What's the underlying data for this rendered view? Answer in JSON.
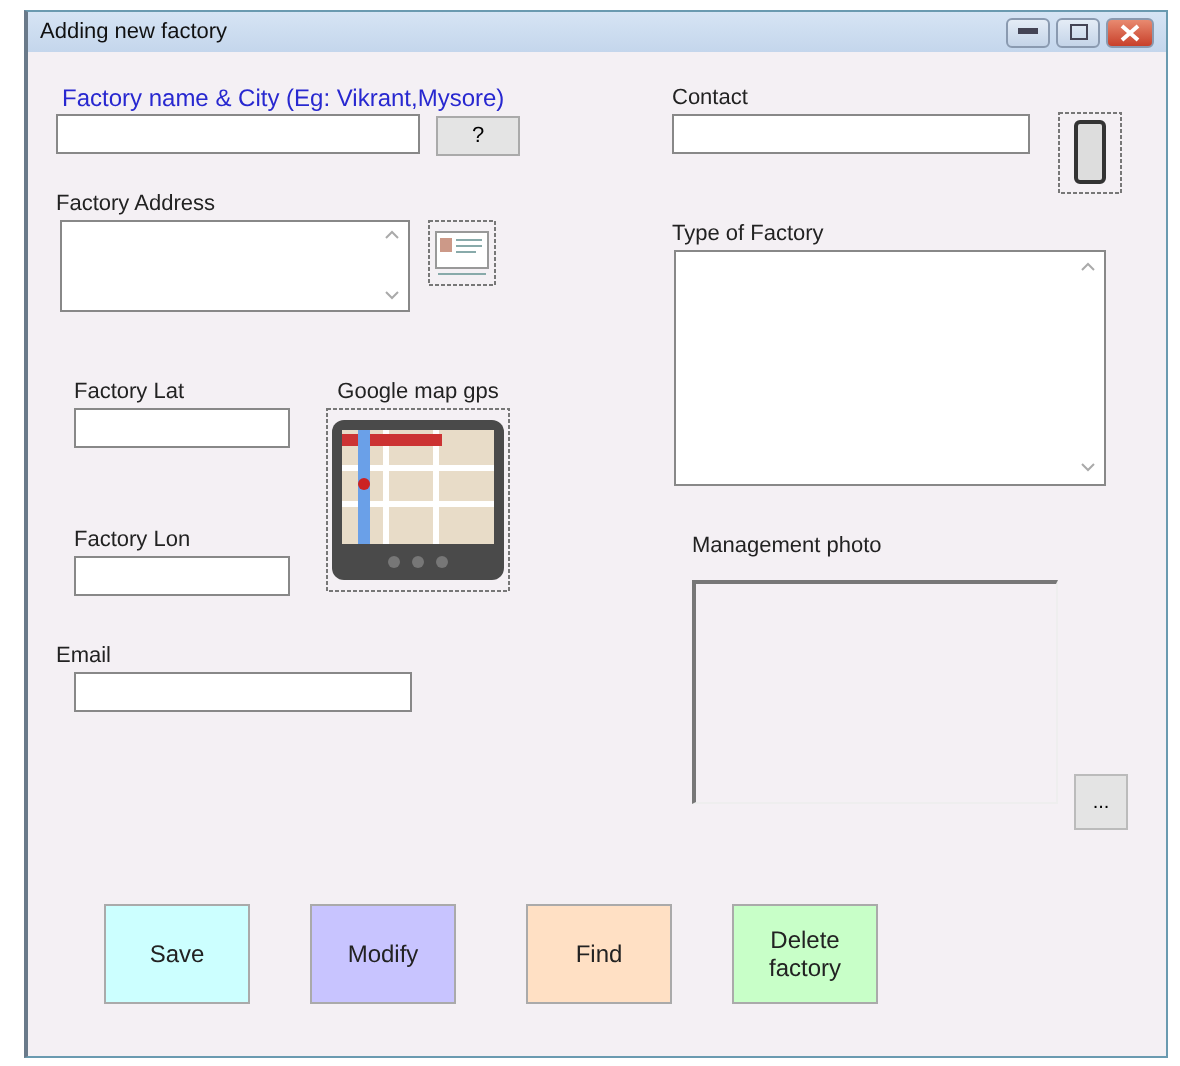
{
  "window": {
    "title": "Adding new factory"
  },
  "name_field": {
    "label": "Factory name & City (Eg: Vikrant,Mysore)",
    "help_button": "?"
  },
  "address_field": {
    "label": "Factory Address"
  },
  "lat_field": {
    "label": "Factory Lat"
  },
  "map": {
    "label": "Google map gps"
  },
  "lon_field": {
    "label": "Factory Lon"
  },
  "email_field": {
    "label": "Email"
  },
  "contact_field": {
    "label": "Contact"
  },
  "type_field": {
    "label": "Type of Factory"
  },
  "photo": {
    "label": "Management photo",
    "browse_button": "..."
  },
  "buttons": [
    {
      "label": "Save",
      "color": "#ccffff"
    },
    {
      "label": "Modify",
      "color": "#c8c4ff"
    },
    {
      "label": "Find",
      "color": "#ffe0c4"
    },
    {
      "label": "Delete factory",
      "color": "#c8ffc8"
    }
  ]
}
